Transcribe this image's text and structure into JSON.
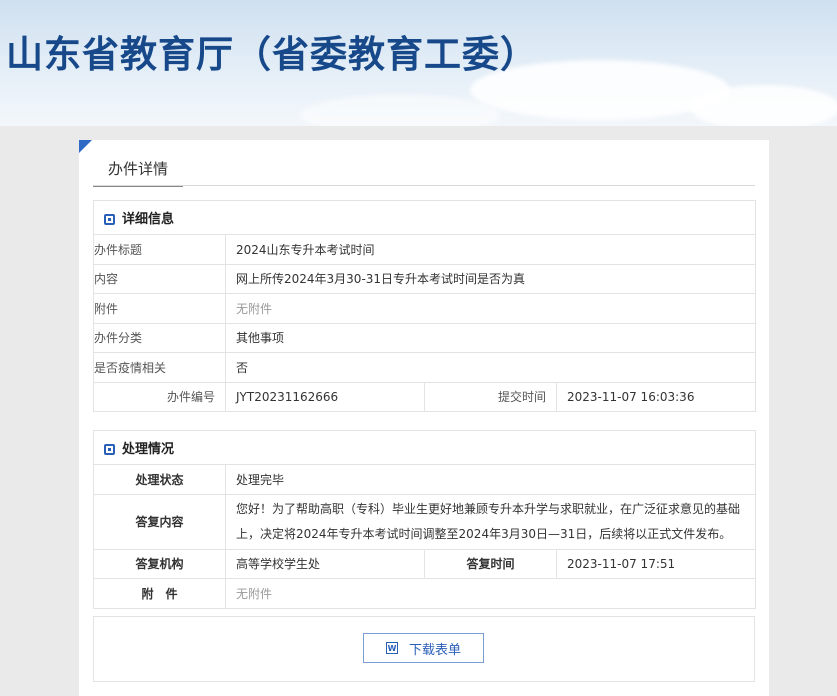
{
  "site": {
    "title": "山东省教育厅（省委教育工委）"
  },
  "page": {
    "tab_label": "办件详情"
  },
  "details": {
    "section_title": "详细信息",
    "rows": [
      {
        "label": "办件标题",
        "value": "2024山东专升本考试时间"
      },
      {
        "label": "内容",
        "value": "网上所传2024年3月30-31日专升本考试时间是否为真"
      },
      {
        "label": "附件",
        "value": "无附件"
      },
      {
        "label": "办件分类",
        "value": "其他事项"
      },
      {
        "label": "是否疫情相关",
        "value": "否"
      }
    ],
    "case_no_label": "办件编号",
    "case_no": "JYT20231162666",
    "submit_time_label": "提交时间",
    "submit_time": "2023-11-07 16:03:36"
  },
  "handling": {
    "section_title": "处理情况",
    "status_label": "处理状态",
    "status": "处理完毕",
    "reply_label": "答复内容",
    "reply": "您好！为了帮助高职（专科）毕业生更好地兼顾专升本升学与求职就业，在广泛征求意见的基础上，决定将2024年专升本考试时间调整至2024年3月30日—31日，后续将以正式文件发布。",
    "org_label": "答复机构",
    "org": "高等学校学生处",
    "reply_time_label": "答复时间",
    "reply_time": "2023-11-07 17:51",
    "attach_label": "附　件",
    "attach": "无附件"
  },
  "download": {
    "label": "下载表单",
    "icon": "word-icon",
    "icon_text": "W"
  },
  "colors": {
    "title_blue": "#17498a",
    "accent": "#2a5fb8"
  }
}
